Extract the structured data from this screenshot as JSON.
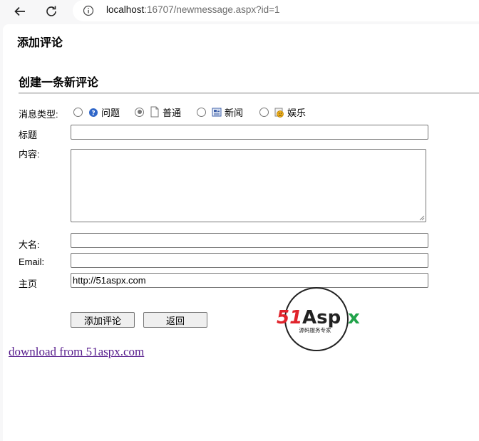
{
  "browser": {
    "url_host": "localhost",
    "url_rest": ":16707/newmessage.aspx?id=1"
  },
  "page": {
    "heading": "添加评论",
    "subheading": "创建一条新评论",
    "type_label": "消息类型:",
    "types": [
      {
        "label": "问题",
        "icon": "question-icon",
        "checked": false
      },
      {
        "label": "普通",
        "icon": "document-icon",
        "checked": true
      },
      {
        "label": "新闻",
        "icon": "news-icon",
        "checked": false
      },
      {
        "label": "娱乐",
        "icon": "entertainment-icon",
        "checked": false
      }
    ],
    "title_label": "标题",
    "content_label": "内容:",
    "name_label": "大名:",
    "email_label": "Email:",
    "homepage_label": "主页",
    "homepage_value": "http://51aspx.com",
    "submit_label": "添加评论",
    "back_label": "返回",
    "download_link": "download from 51aspx.com"
  },
  "logo": {
    "brand_number": "51",
    "brand_name": "Aspx",
    "slogan": "源码服务专家",
    "colors": {
      "red": "#e0232b",
      "green": "#21a34a",
      "dark": "#222222"
    }
  }
}
